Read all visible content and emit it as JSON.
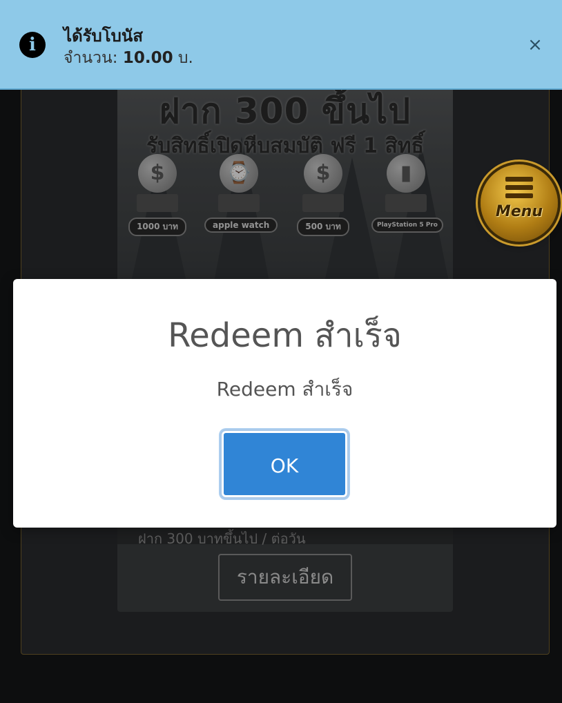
{
  "toast": {
    "icon": "info-icon",
    "icon_glyph": "i",
    "title": "ได้รับโบนัส",
    "amount_label": "จำนวน:",
    "amount_value": "10.00",
    "amount_unit": "บ.",
    "close_glyph": "×",
    "background_color": "#8ec9e8"
  },
  "promo": {
    "headline_line1": "ฝาก 300 ขึ้นไป",
    "headline_line2": "รับสิทธิ์เปิดหีบสมบัติ ฟรี 1 สิทธิ์",
    "prizes": [
      {
        "label": "1000 บาท",
        "icon": "coin-icon",
        "glyph": "$"
      },
      {
        "label": "apple watch",
        "icon": "watch-icon",
        "glyph": "⌚"
      },
      {
        "label": "500 บาท",
        "icon": "coin-icon",
        "glyph": "$"
      },
      {
        "label": "PlayStation 5 Pro",
        "icon": "console-icon",
        "glyph": "▮"
      }
    ],
    "condition": "ฝาก 300 บาทขึ้นไป / ต่อวัน",
    "detail_button": "รายละเอียด"
  },
  "menu": {
    "label": "Menu",
    "icon": "hamburger-icon",
    "accent_color": "#d4a22a"
  },
  "modal": {
    "title": "Redeem สำเร็จ",
    "text": "Redeem สำเร็จ",
    "ok_button": "OK",
    "button_color": "#3085d6"
  }
}
